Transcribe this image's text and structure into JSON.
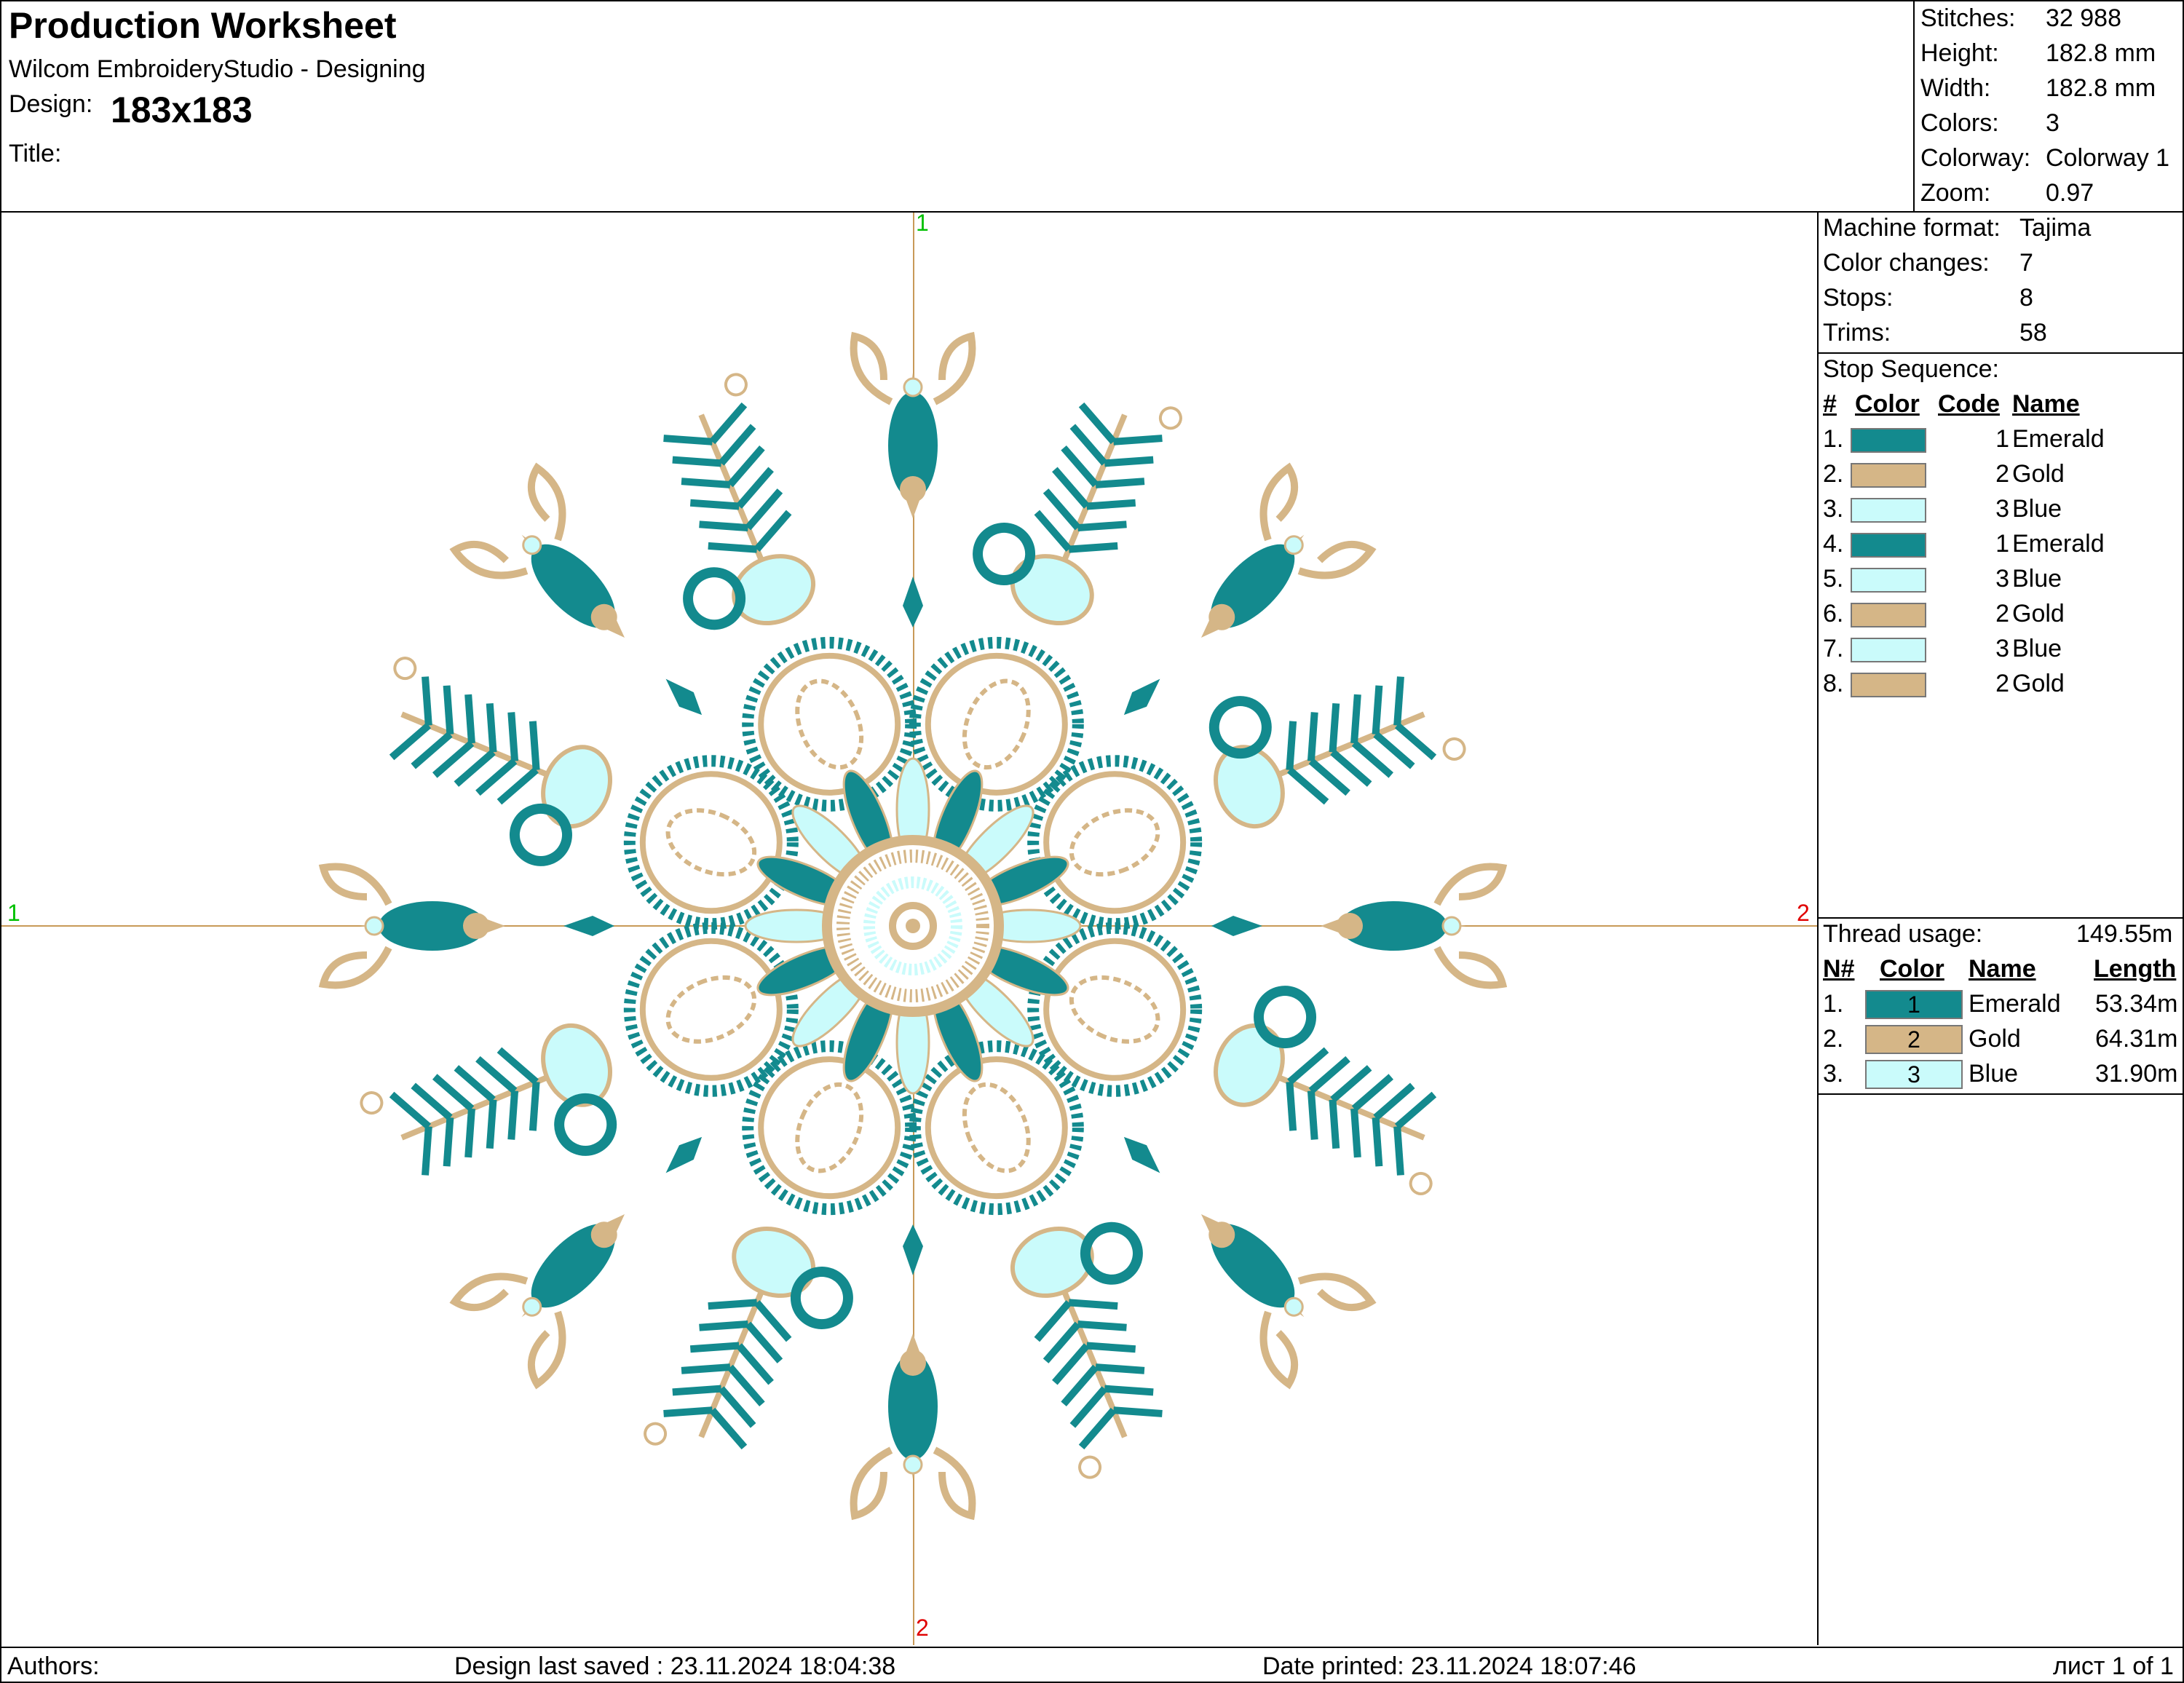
{
  "header": {
    "title": "Production Worksheet",
    "app": "Wilcom EmbroideryStudio - Designing",
    "design_label": "Design:",
    "design_value": "183x183",
    "title_label": "Title:"
  },
  "summary": [
    {
      "label": "Stitches:",
      "value": "32 988"
    },
    {
      "label": "Height:",
      "value": "182.8 mm"
    },
    {
      "label": "Width:",
      "value": "182.8 mm"
    },
    {
      "label": "Colors:",
      "value": "3"
    },
    {
      "label": "Colorway:",
      "value": "Colorway 1"
    },
    {
      "label": "Zoom:",
      "value": "0.97"
    }
  ],
  "machine": [
    {
      "label": "Machine format:",
      "value": "Tajima"
    },
    {
      "label": "Color changes:",
      "value": "7"
    },
    {
      "label": "Stops:",
      "value": "8"
    },
    {
      "label": "Trims:",
      "value": "58"
    }
  ],
  "stop_sequence": {
    "title": "Stop Sequence:",
    "headers": [
      "#",
      "Color",
      "Code",
      "Name"
    ],
    "rows": [
      {
        "n": "1.",
        "color": "#138a8e",
        "code": "1",
        "name": "Emerald"
      },
      {
        "n": "2.",
        "color": "#d5b687",
        "code": "2",
        "name": "Gold"
      },
      {
        "n": "3.",
        "color": "#cafbfb",
        "code": "3",
        "name": "Blue"
      },
      {
        "n": "4.",
        "color": "#138a8e",
        "code": "1",
        "name": "Emerald"
      },
      {
        "n": "5.",
        "color": "#cafbfb",
        "code": "3",
        "name": "Blue"
      },
      {
        "n": "6.",
        "color": "#d5b687",
        "code": "2",
        "name": "Gold"
      },
      {
        "n": "7.",
        "color": "#cafbfb",
        "code": "3",
        "name": "Blue"
      },
      {
        "n": "8.",
        "color": "#d5b687",
        "code": "2",
        "name": "Gold"
      }
    ]
  },
  "thread_usage": {
    "title": "Thread usage:",
    "total": "149.55m",
    "headers": [
      "N#",
      "Color",
      "Name",
      "Length"
    ],
    "rows": [
      {
        "n": "1.",
        "color": "#138a8e",
        "code": "1",
        "name": "Emerald",
        "length": "53.34m"
      },
      {
        "n": "2.",
        "color": "#d5b687",
        "code": "2",
        "name": "Gold",
        "length": "64.31m"
      },
      {
        "n": "3.",
        "color": "#cafbfb",
        "code": "3",
        "name": "Blue",
        "length": "31.90m"
      }
    ]
  },
  "canvas": {
    "marker_left": "1",
    "marker_right": "2",
    "marker_top": "1",
    "marker_bottom": "2",
    "colors": {
      "emerald": "#138a8e",
      "gold": "#d5b687",
      "blue": "#cafbfb",
      "start": "#00c000",
      "end": "#e00000"
    }
  },
  "footer": {
    "authors": "Authors:",
    "saved": "Design last saved : 23.11.2024 18:04:38",
    "printed": "Date printed: 23.11.2024 18:07:46",
    "page": "лист 1 of 1"
  }
}
